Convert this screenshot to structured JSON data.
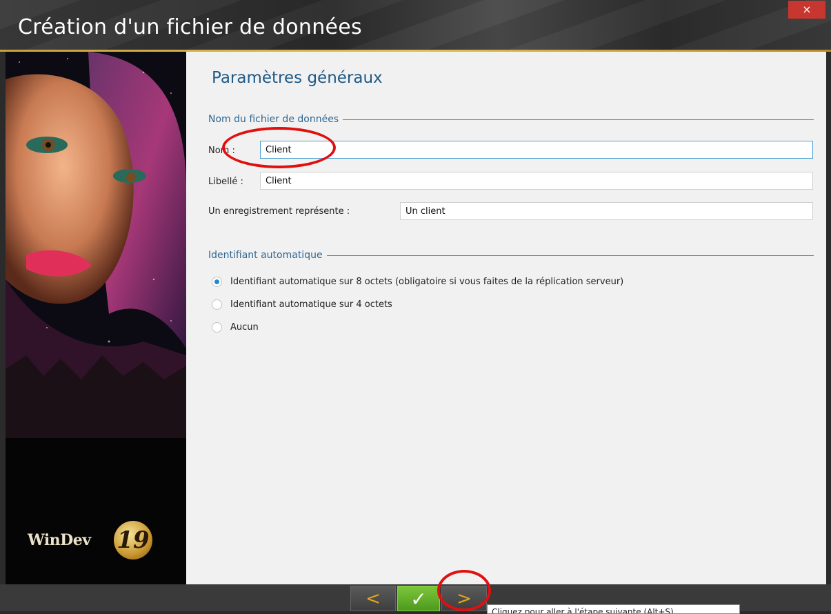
{
  "window": {
    "title": "Création d'un fichier de données",
    "close_label": "×"
  },
  "sidebar": {
    "logo_text": "WinDev",
    "logo_number": "19"
  },
  "page": {
    "heading": "Paramètres généraux",
    "section_file": "Nom du fichier de données",
    "nom_label": "Nom :",
    "nom_value": "Client",
    "libelle_label": "Libellé :",
    "libelle_value": "Client",
    "record_label": "Un enregistrement représente :",
    "record_value": "Un client",
    "section_id": "Identifiant automatique",
    "radios": [
      {
        "label": "Identifiant automatique sur 8 octets (obligatoire si vous faites de  la réplication serveur)",
        "selected": true
      },
      {
        "label": "Identifiant automatique sur 4 octets",
        "selected": false
      },
      {
        "label": "Aucun",
        "selected": false
      }
    ]
  },
  "footer": {
    "prev_label": "<",
    "ok_label": "✓",
    "next_label": ">",
    "tooltip": "Cliquez pour aller à l'étape suivante (Alt+S)"
  },
  "colors": {
    "accent": "#1f5a86",
    "radio_selected": "#1e8ad6",
    "annotation": "#e01010",
    "ok_green": "#5aa826",
    "arrow_gold": "#e3a814"
  }
}
